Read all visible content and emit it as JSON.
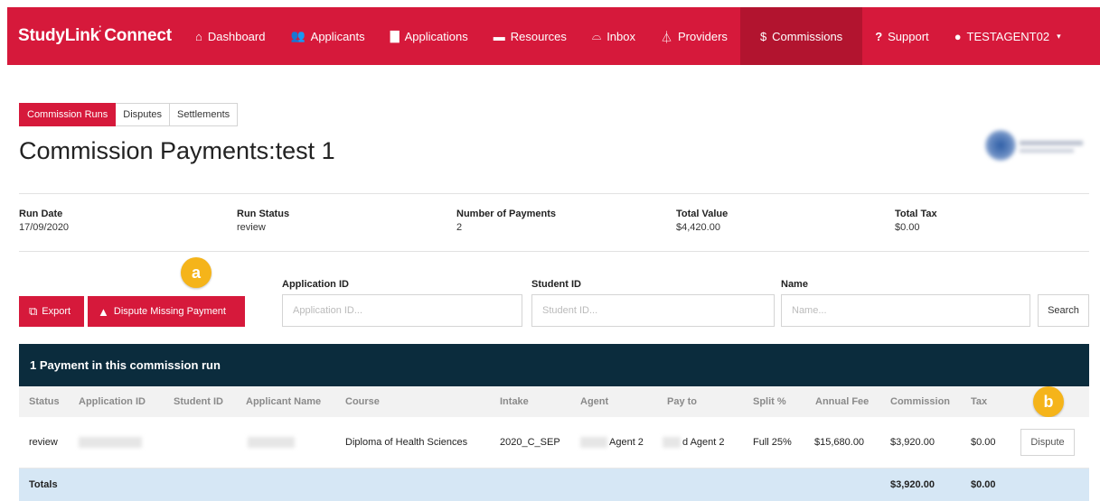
{
  "nav": {
    "brand_part1": "StudyLink",
    "brand_part2": "Connect",
    "items": [
      {
        "label": "Dashboard",
        "icon": "home-icon"
      },
      {
        "label": "Applicants",
        "icon": "users-icon"
      },
      {
        "label": "Applications",
        "icon": "file-icon"
      },
      {
        "label": "Resources",
        "icon": "folder-icon"
      },
      {
        "label": "Inbox",
        "icon": "inbox-icon"
      },
      {
        "label": "Providers",
        "icon": "institution-icon"
      },
      {
        "label": "Commissions",
        "icon": "dollar-icon",
        "active": true
      },
      {
        "label": "Support",
        "icon": "question-icon"
      },
      {
        "label": "TESTAGENT02",
        "icon": "user-icon"
      }
    ]
  },
  "tabs": [
    "Commission Runs",
    "Disputes",
    "Settlements"
  ],
  "page_title": "Commission Payments:test 1",
  "summary": [
    {
      "label": "Run Date",
      "value": "17/09/2020"
    },
    {
      "label": "Run Status",
      "value": "review"
    },
    {
      "label": "Number of Payments",
      "value": "2"
    },
    {
      "label": "Total Value",
      "value": "$4,420.00"
    },
    {
      "label": "Total Tax",
      "value": "$0.00"
    }
  ],
  "actions": {
    "export_label": "Export",
    "dispute_missing_label": "Dispute Missing Payment",
    "search_label": "Search"
  },
  "badges": {
    "a": "a",
    "b": "b"
  },
  "filters": {
    "application_id": {
      "label": "Application ID",
      "placeholder": "Application ID..."
    },
    "student_id": {
      "label": "Student ID",
      "placeholder": "Student ID..."
    },
    "name": {
      "label": "Name",
      "placeholder": "Name..."
    }
  },
  "table": {
    "title": "1 Payment in this commission run",
    "columns": [
      "Status",
      "Application ID",
      "Student ID",
      "Applicant Name",
      "Course",
      "Intake",
      "Agent",
      "Pay to",
      "Split %",
      "Annual Fee",
      "Commission",
      "Tax"
    ],
    "row": {
      "status": "review",
      "course": "Diploma of Health Sciences",
      "intake": "2020_C_SEP",
      "agent": "Agent 2",
      "pay_to": "d Agent 2",
      "split": "Full 25%",
      "annual_fee": "$15,680.00",
      "commission": "$3,920.00",
      "tax": "$0.00",
      "action": "Dispute"
    },
    "totals": {
      "label": "Totals",
      "commission": "$3,920.00",
      "tax": "$0.00"
    }
  },
  "colors": {
    "brand_red": "#d6193b",
    "nav_active": "#b2142f",
    "table_header": "#0b2c3d",
    "totals_row": "#d6e7f5",
    "badge": "#f5b41a"
  }
}
